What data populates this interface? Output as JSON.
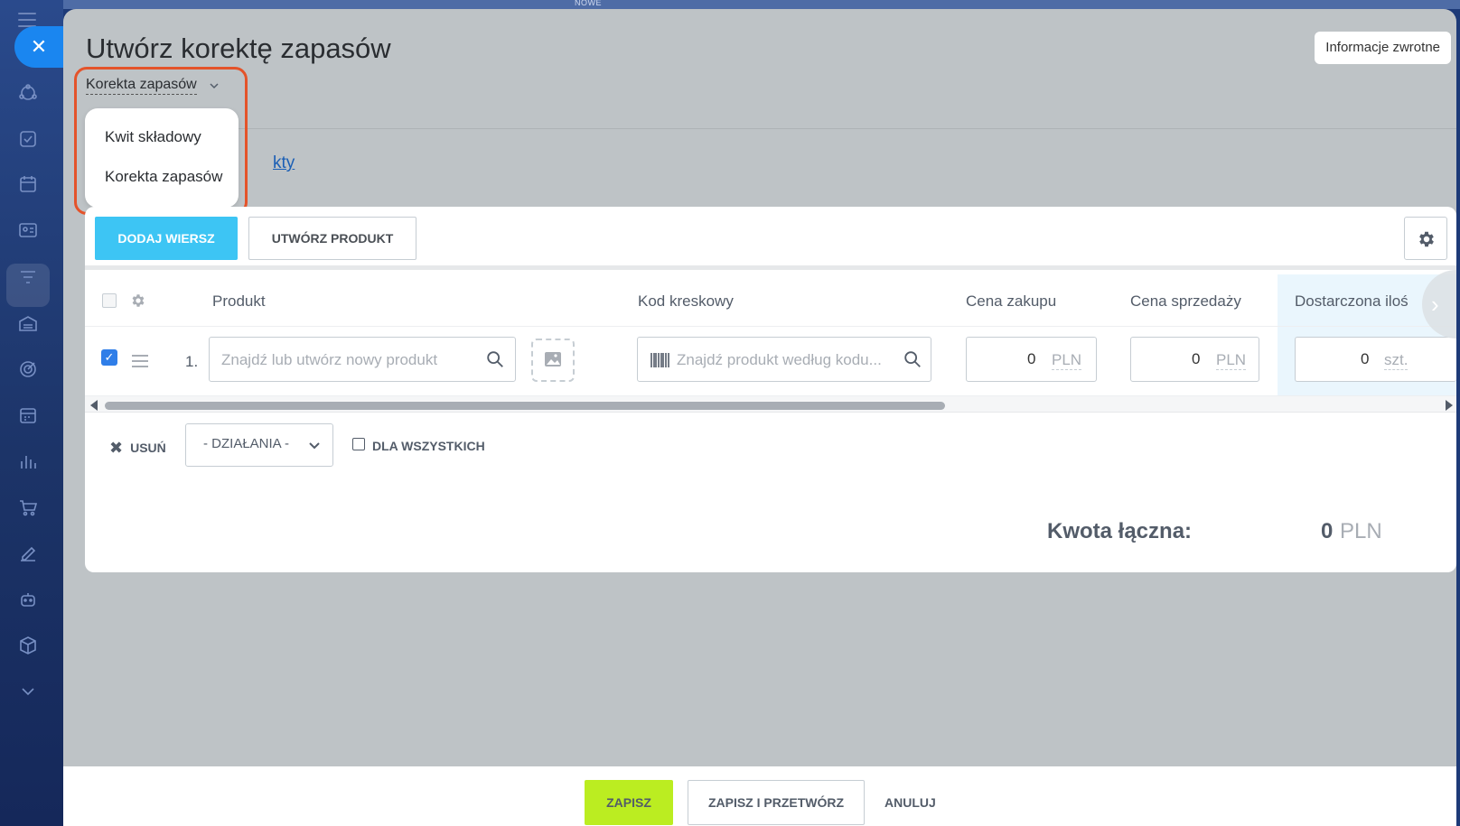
{
  "sidebar": {
    "icons": [
      "menu-icon",
      "close-icon",
      "funnel-share-icon",
      "tasks-check-icon",
      "calendar-icon",
      "contact-card-icon",
      "filter-icon",
      "warehouse-icon",
      "target-icon",
      "schedule-icon",
      "bar-chart-icon",
      "cart-icon",
      "edit-icon",
      "robot-icon",
      "box-icon",
      "chevron-down-icon"
    ]
  },
  "top": {
    "badge": "NOWE"
  },
  "header": {
    "title": "Utwórz korektę zapasów",
    "feedback_button": "Informacje zwrotne",
    "doc_type_selected": "Korekta zapasów",
    "products_tab_partial": "kty"
  },
  "doc_type_menu": {
    "items": [
      "Kwit składowy",
      "Korekta zapasów"
    ]
  },
  "toolbar": {
    "add_row": "DODAJ WIERSZ",
    "create_product": "UTWÓRZ PRODUKT"
  },
  "table": {
    "columns": [
      "Produkt",
      "Kod kreskowy",
      "Cena zakupu",
      "Cena sprzedaży",
      "Dostarczona iloś"
    ],
    "rows": [
      {
        "number": "1.",
        "product_placeholder": "Znajdź lub utwórz nowy produkt",
        "barcode_placeholder": "Znajdź produkt według kodu...",
        "purchase_price": "0",
        "purchase_currency": "PLN",
        "sale_price": "0",
        "sale_currency": "PLN",
        "delivered_qty": "0",
        "delivered_unit": "szt."
      }
    ]
  },
  "actions": {
    "delete": "USUŃ",
    "actions_select": "- DZIAŁANIA -",
    "for_all": "DLA WSZYSTKICH"
  },
  "total": {
    "label": "Kwota łączna:",
    "value": "0",
    "currency": "PLN"
  },
  "footer": {
    "save": "ZAPISZ",
    "save_process": "ZAPISZ I PRZETWÓRZ",
    "cancel": "ANULUJ"
  },
  "colors": {
    "accent_blue": "#3dc5f4",
    "save_green": "#bbed21",
    "highlight_red": "#e4532a",
    "close_blue": "#1a86f0"
  }
}
